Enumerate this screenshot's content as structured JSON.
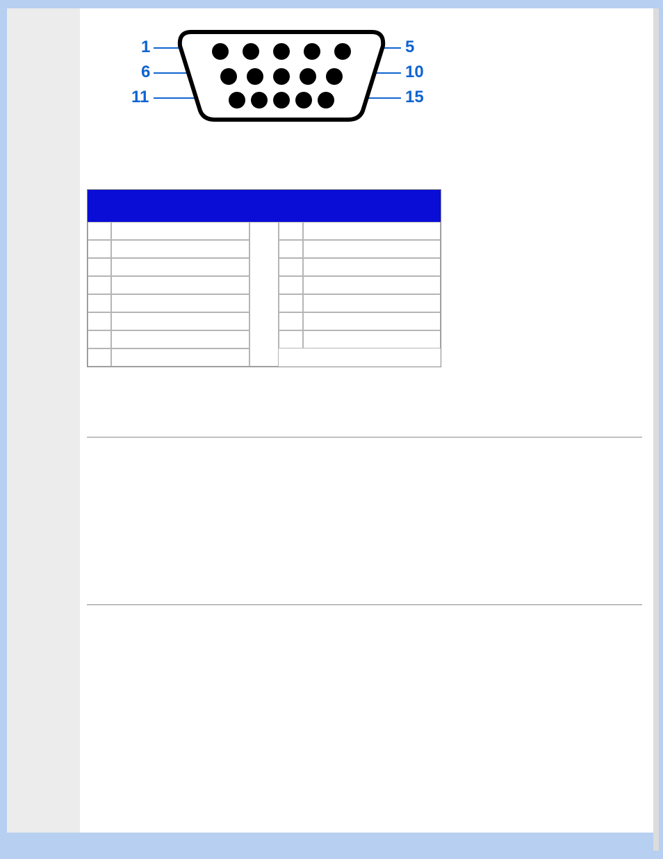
{
  "connector": {
    "labels": {
      "row1_start": "1",
      "row1_end": "5",
      "row2_start": "6",
      "row2_end": "10",
      "row3_start": "11",
      "row3_end": "15"
    }
  },
  "pin_table": {
    "headers": {
      "pin": "",
      "signal": "",
      "pin2": "",
      "signal2": ""
    },
    "left_rows": [
      {
        "pin": "",
        "sig": ""
      },
      {
        "pin": "",
        "sig": ""
      },
      {
        "pin": "",
        "sig": ""
      },
      {
        "pin": "",
        "sig": ""
      },
      {
        "pin": "",
        "sig": ""
      },
      {
        "pin": "",
        "sig": ""
      },
      {
        "pin": "",
        "sig": ""
      },
      {
        "pin": "",
        "sig": ""
      }
    ],
    "right_rows": [
      {
        "pin": "",
        "sig": ""
      },
      {
        "pin": "",
        "sig": ""
      },
      {
        "pin": "",
        "sig": ""
      },
      {
        "pin": "",
        "sig": ""
      },
      {
        "pin": "",
        "sig": ""
      },
      {
        "pin": "",
        "sig": ""
      },
      {
        "pin": "",
        "sig": ""
      }
    ]
  }
}
